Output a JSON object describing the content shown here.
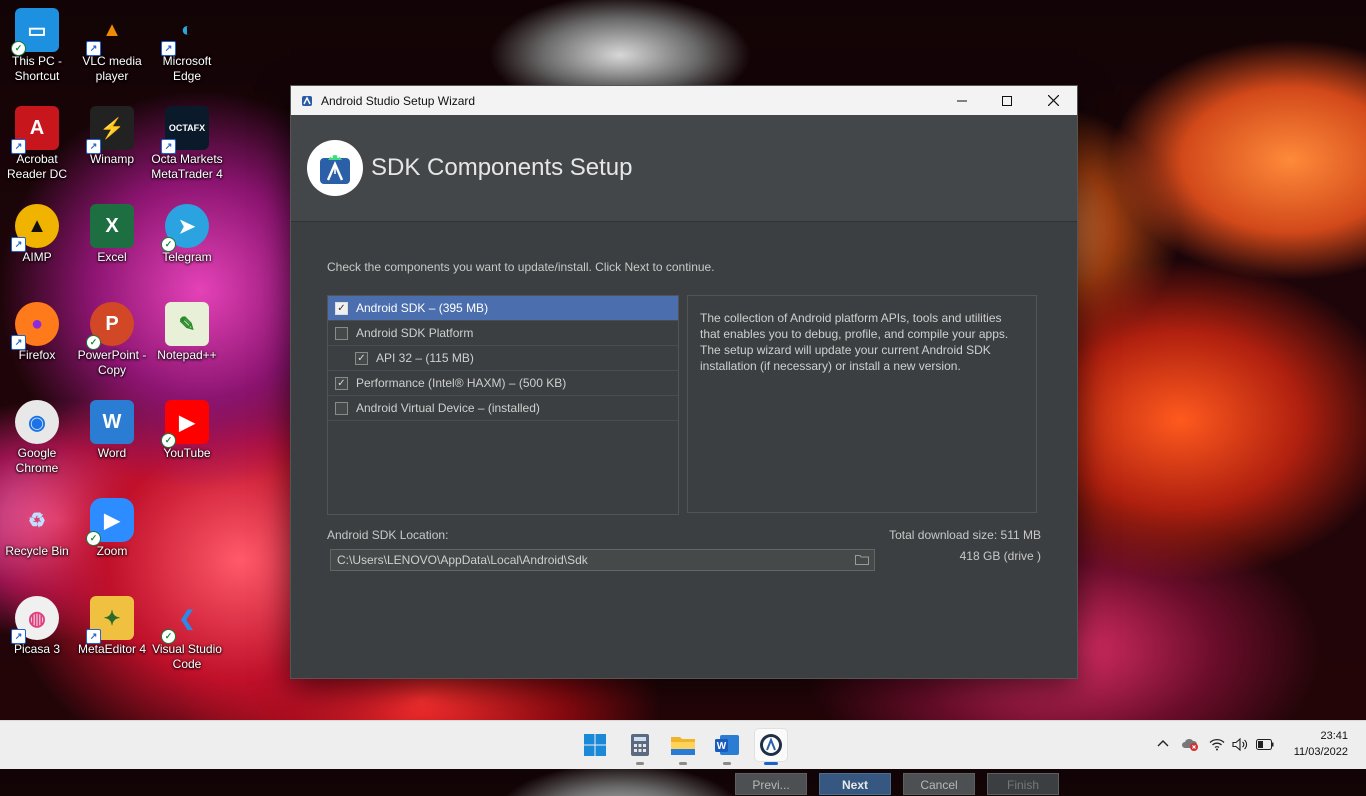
{
  "desktop": {
    "icons": [
      {
        "label_l1": "This PC -",
        "label_l2": "Shortcut",
        "icon": "monitor-icon"
      },
      {
        "label_l1": "VLC media",
        "label_l2": "player",
        "icon": "vlc-icon"
      },
      {
        "label_l1": "Microsoft",
        "label_l2": "Edge",
        "icon": "edge-icon"
      },
      {
        "label_l1": "Acrobat",
        "label_l2": "Reader DC",
        "icon": "acrobat-icon"
      },
      {
        "label_l1": "Winamp",
        "label_l2": "",
        "icon": "winamp-icon"
      },
      {
        "label_l1": "Octa Markets",
        "label_l2": "MetaTrader 4",
        "icon": "octafx-icon",
        "logo_text": "OCTAFX"
      },
      {
        "label_l1": "AIMP",
        "label_l2": "",
        "icon": "aimp-icon"
      },
      {
        "label_l1": "Excel",
        "label_l2": "",
        "icon": "excel-icon",
        "logo_text": "X"
      },
      {
        "label_l1": "Telegram",
        "label_l2": "",
        "icon": "telegram-icon"
      },
      {
        "label_l1": "Firefox",
        "label_l2": "",
        "icon": "firefox-icon"
      },
      {
        "label_l1": "PowerPoint -",
        "label_l2": "Copy",
        "icon": "powerpoint-icon",
        "logo_text": "P"
      },
      {
        "label_l1": "Notepad++",
        "label_l2": "",
        "icon": "notepadpp-icon"
      },
      {
        "label_l1": "Google",
        "label_l2": "Chrome",
        "icon": "chrome-icon"
      },
      {
        "label_l1": "Word",
        "label_l2": "",
        "icon": "word-icon",
        "logo_text": "W"
      },
      {
        "label_l1": "YouTube",
        "label_l2": "",
        "icon": "youtube-icon"
      },
      {
        "label_l1": "Recycle Bin",
        "label_l2": "",
        "icon": "recycle-bin-icon"
      },
      {
        "label_l1": "Zoom",
        "label_l2": "",
        "icon": "zoom-icon"
      },
      {
        "label_l1": "",
        "label_l2": "",
        "icon": "empty"
      },
      {
        "label_l1": "Picasa 3",
        "label_l2": "",
        "icon": "picasa-icon"
      },
      {
        "label_l1": "MetaEditor 4",
        "label_l2": "",
        "icon": "metaeditor-icon"
      },
      {
        "label_l1": "Visual Studio",
        "label_l2": "Code",
        "icon": "vscode-icon"
      }
    ]
  },
  "dialog": {
    "window_title": "Android Studio Setup Wizard",
    "header_title": "SDK Components Setup",
    "instruction": "Check the components you want to update/install. Click Next to continue.",
    "components": [
      {
        "label": "Android SDK – (395 MB)",
        "checked": true,
        "selected": true,
        "indent": false
      },
      {
        "label": "Android SDK Platform",
        "checked": false,
        "selected": false,
        "indent": false
      },
      {
        "label": "API 32 – (115 MB)",
        "checked": true,
        "selected": false,
        "indent": true
      },
      {
        "label": "Performance (Intel® HAXM) – (500 KB)",
        "checked": true,
        "selected": false,
        "indent": false
      },
      {
        "label": "Android Virtual Device – (installed)",
        "checked": false,
        "selected": false,
        "indent": false
      }
    ],
    "description": "The collection of Android platform APIs, tools and utilities that enables you to debug, profile, and compile your apps. The setup wizard will update your current Android SDK installation (if necessary) or install a new version.",
    "sdk_location_label": "Android SDK Location:",
    "sdk_location_value": "C:\\Users\\LENOVO\\AppData\\Local\\Android\\Sdk",
    "total_download": "Total download size: 511 MB",
    "drive_space": "418 GB (drive )",
    "buttons": {
      "previous": "Previ...",
      "next": "Next",
      "cancel": "Cancel",
      "finish": "Finish"
    }
  },
  "taskbar": {
    "apps": [
      "windows-start-icon",
      "calculator-icon",
      "file-explorer-icon",
      "word-icon",
      "android-studio-icon"
    ],
    "clock_time": "23:41",
    "clock_date": "11/03/2022"
  }
}
